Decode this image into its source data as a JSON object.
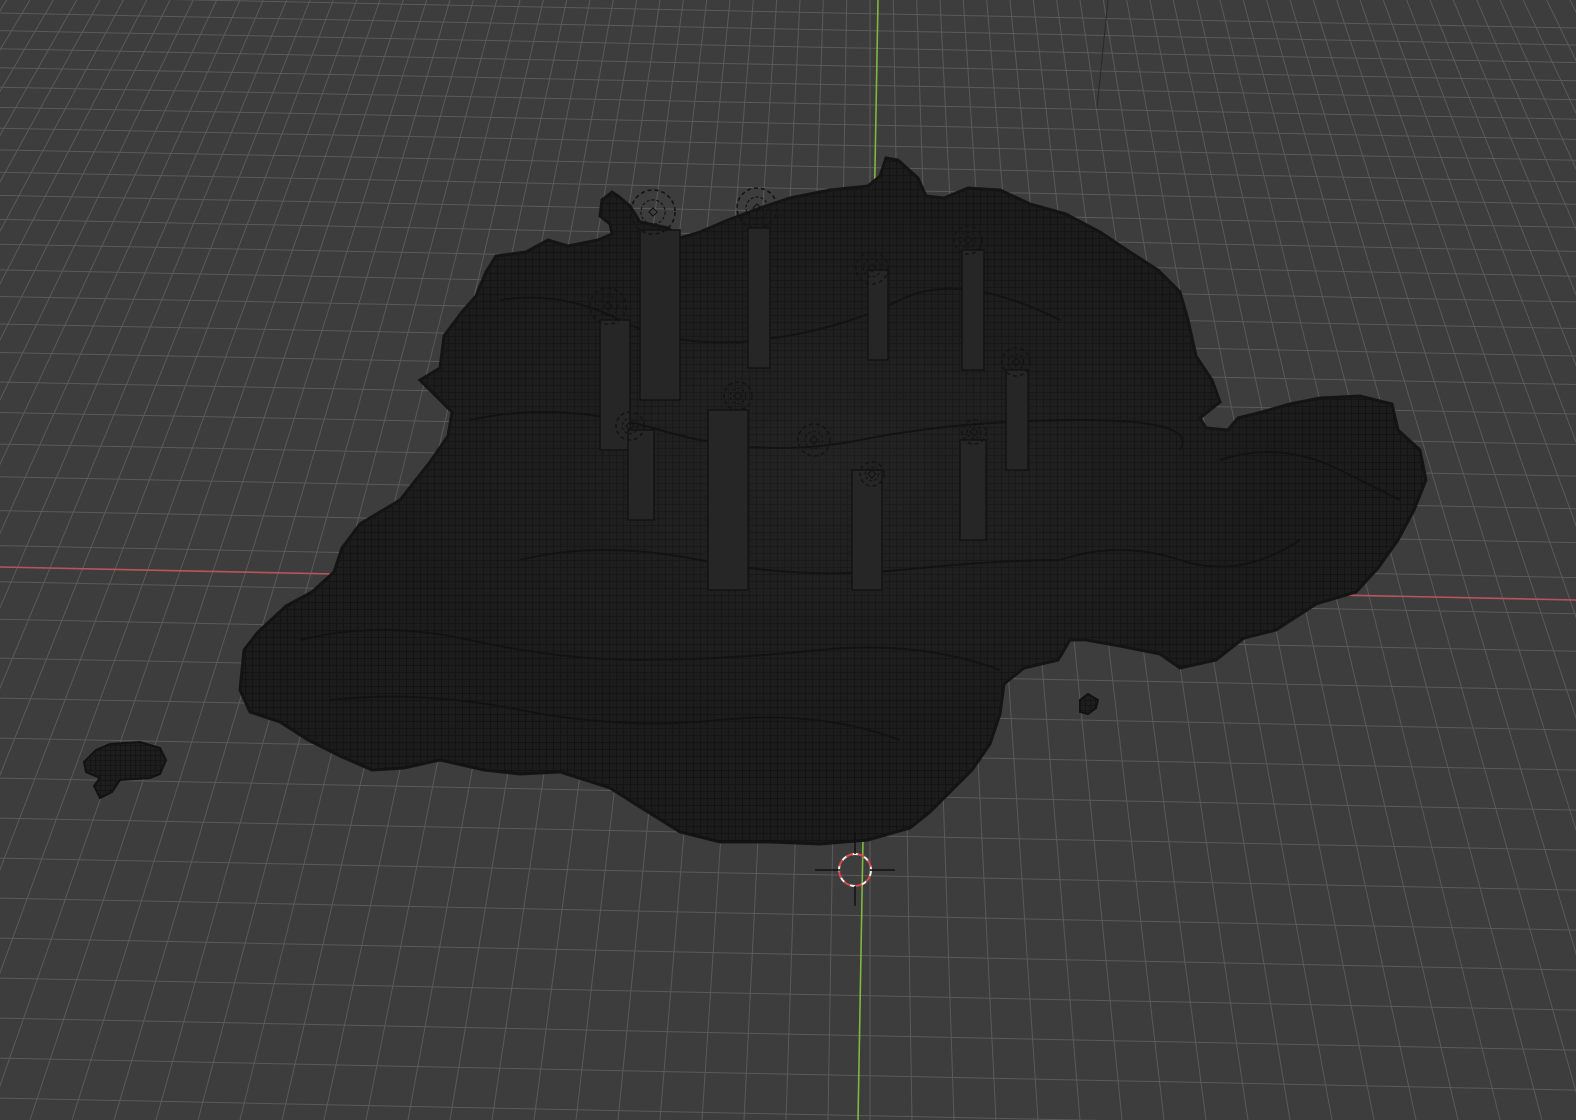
{
  "viewport": {
    "background_color": "#3d3d3d",
    "grid_color": "#5a5a5a",
    "x_axis_color": "#b8545c",
    "y_axis_color": "#7fb83f",
    "mesh_fill_color": "#202020",
    "mesh_wire_color": "#121212",
    "mesh_highlight_color": "#2b2b2b",
    "cursor_ring_colors": [
      "#d94a4a",
      "#f2f2f2"
    ],
    "cursor_icon": "3d-cursor-icon",
    "marker_icon": "empty-marker-icon",
    "objects": [
      {
        "name": "terrain-mesh",
        "kind": "mesh"
      },
      {
        "name": "small-fragment-left",
        "kind": "mesh"
      },
      {
        "name": "small-fragment-right",
        "kind": "mesh"
      }
    ]
  }
}
